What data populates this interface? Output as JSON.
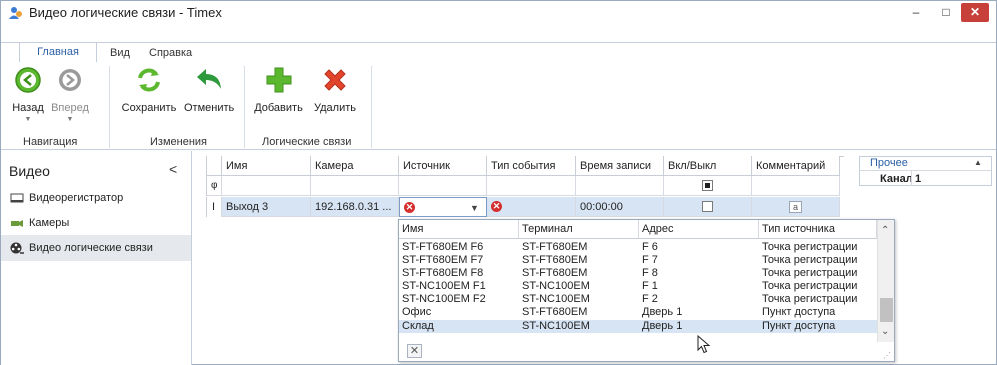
{
  "window": {
    "title": "Видео логические связи - Timex",
    "minimize": "–",
    "maximize": "□",
    "close": "✕"
  },
  "tabs": [
    {
      "label": "Главная"
    },
    {
      "label": "Вид"
    },
    {
      "label": "Справка"
    }
  ],
  "ribbon": {
    "back": "Назад",
    "forward": "Вперед",
    "save": "Сохранить",
    "undo": "Отменить",
    "add": "Добавить",
    "delete": "Удалить",
    "group_nav": "Навигация",
    "group_changes": "Изменения",
    "group_links": "Логические связи"
  },
  "nav": {
    "title": "Видео",
    "collapse": "<",
    "items": [
      {
        "label": "Видеорегистратор"
      },
      {
        "label": "Камеры"
      },
      {
        "label": "Видео логические связи"
      }
    ]
  },
  "grid": {
    "columns": [
      "Имя",
      "Камера",
      "Источник",
      "Тип события",
      "Время записи",
      "Вкл/Выкл",
      "Комментарий"
    ],
    "filter_marker": "φ",
    "edit_marker": "I",
    "row": {
      "name": "Выход 3",
      "camera": "192.168.0.31 ...",
      "time": "00:00:00",
      "comment_icon": "a"
    }
  },
  "props": {
    "header": "Прочее",
    "row_label": "Канал",
    "row_value": "1",
    "collapse": "▲"
  },
  "popup": {
    "columns": [
      "Имя",
      "Терминал",
      "Адрес",
      "Тип источника"
    ],
    "rows": [
      {
        "name": "ST-FT680EM F6",
        "terminal": "ST-FT680EM",
        "address": "F 6",
        "type": "Точка регистрации"
      },
      {
        "name": "ST-FT680EM F7",
        "terminal": "ST-FT680EM",
        "address": "F 7",
        "type": "Точка регистрации"
      },
      {
        "name": "ST-FT680EM F8",
        "terminal": "ST-FT680EM",
        "address": "F 8",
        "type": "Точка регистрации"
      },
      {
        "name": "ST-NC100EM F1",
        "terminal": "ST-NC100EM",
        "address": "F 1",
        "type": "Точка регистрации"
      },
      {
        "name": "ST-NC100EM F2",
        "terminal": "ST-NC100EM",
        "address": "F 2",
        "type": "Точка регистрации"
      },
      {
        "name": "Офис",
        "terminal": "ST-FT680EM",
        "address": "Дверь 1",
        "type": "Пункт доступа"
      },
      {
        "name": "Склад",
        "terminal": "ST-NC100EM",
        "address": "Дверь 1",
        "type": "Пункт доступа"
      }
    ],
    "clear": "✕"
  },
  "colors": {
    "accent": "#2b5fa5",
    "close_button": "#c7403a",
    "selection": "#d7e4f3",
    "error_icon": "#d42e2e"
  }
}
